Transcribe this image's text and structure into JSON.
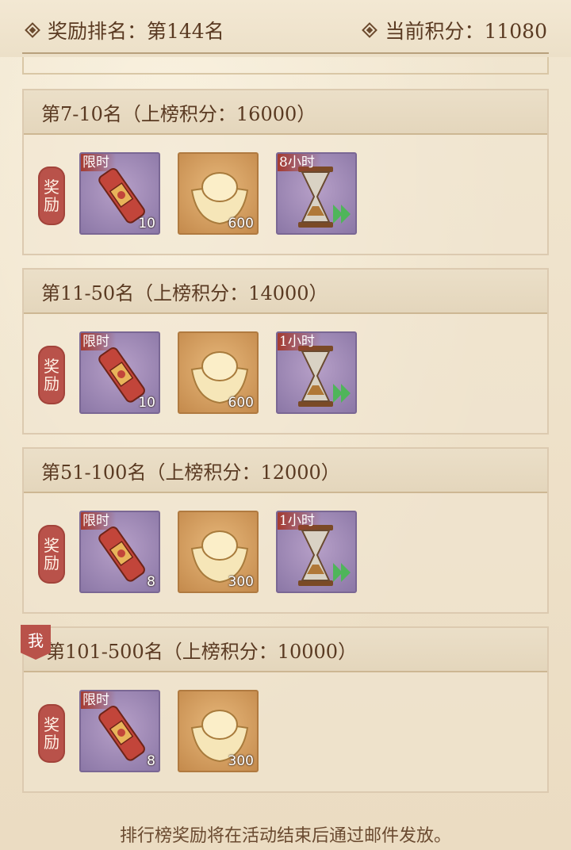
{
  "header": {
    "rank_label": "奖励排名：第144名",
    "score_label": "当前积分：11080"
  },
  "reward_label": "奖励",
  "me_label": "我",
  "sections": [
    {
      "title": "第7-10名（上榜积分：16000）",
      "items": [
        {
          "icon": "red-token-icon",
          "badge": "限时",
          "count": "10"
        },
        {
          "icon": "gold-ingot-icon",
          "badge": "",
          "count": "600"
        },
        {
          "icon": "hourglass-speedup-icon",
          "badge": "8小时",
          "count": ""
        }
      ]
    },
    {
      "title": "第11-50名（上榜积分：14000）",
      "items": [
        {
          "icon": "red-token-icon",
          "badge": "限时",
          "count": "10"
        },
        {
          "icon": "gold-ingot-icon",
          "badge": "",
          "count": "600"
        },
        {
          "icon": "hourglass-speedup-icon",
          "badge": "1小时",
          "count": ""
        }
      ]
    },
    {
      "title": "第51-100名（上榜积分：12000）",
      "items": [
        {
          "icon": "red-token-icon",
          "badge": "限时",
          "count": "8"
        },
        {
          "icon": "gold-ingot-icon",
          "badge": "",
          "count": "300"
        },
        {
          "icon": "hourglass-speedup-icon",
          "badge": "1小时",
          "count": ""
        }
      ]
    },
    {
      "title": "第101-500名（上榜积分：10000）",
      "items": [
        {
          "icon": "red-token-icon",
          "badge": "限时",
          "count": "8"
        },
        {
          "icon": "gold-ingot-icon",
          "badge": "",
          "count": "300"
        }
      ]
    }
  ],
  "footer": "排行榜奖励将在活动结束后通过邮件发放。"
}
